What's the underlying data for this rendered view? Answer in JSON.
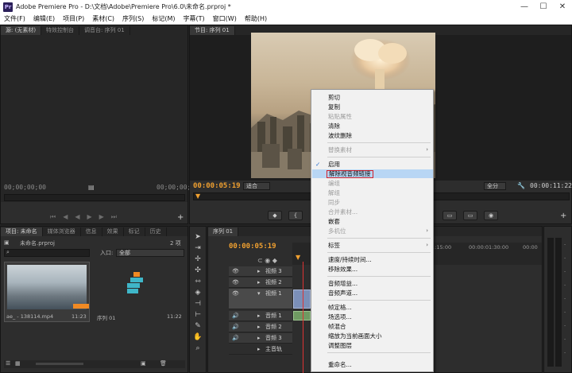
{
  "app": {
    "logo": "Pr",
    "title": "Adobe Premiere Pro - D:\\文档\\Adobe\\Premiere Pro\\6.0\\未命名.prproj *"
  },
  "menubar": [
    "文件(F)",
    "编辑(E)",
    "项目(P)",
    "素材(C)",
    "序列(S)",
    "标记(M)",
    "字幕(T)",
    "窗口(W)",
    "帮助(H)"
  ],
  "source_panel": {
    "tabs": [
      "源: (无素材)",
      "特效控制台",
      "调音台: 序列 01"
    ],
    "timecode_left": "00;00;00;00",
    "timecode_right": "00;00;00;00"
  },
  "program_panel": {
    "tab": "节目: 序列 01",
    "timecode": "00:00:05:19",
    "fit_label": "适合",
    "quality_label": "全分",
    "duration": "00:00:11:22"
  },
  "project_panel": {
    "tabs": [
      "项目: 未命名",
      "媒体浏览器",
      "信息",
      "效果",
      "标记",
      "历史"
    ],
    "file": "未命名.prproj",
    "item_count": "2 项",
    "inpoint_label": "入口:",
    "inpoint_value": "全部",
    "clips": [
      {
        "name": "ae_ - 138114.mp4",
        "duration": "11:23"
      },
      {
        "name": "序列 01",
        "duration": "11:22"
      }
    ]
  },
  "timeline": {
    "tab": "序列 01",
    "timecode": "00:00:05:19",
    "ruler": [
      "00:00:01:15:00",
      "00:00:01:30:00",
      "00:00"
    ],
    "tracks": [
      {
        "label": "视频 3",
        "type": "video"
      },
      {
        "label": "视频 2",
        "type": "video"
      },
      {
        "label": "视频 1",
        "type": "video"
      },
      {
        "label": "音频 1",
        "type": "audio"
      },
      {
        "label": "音频 2",
        "type": "audio"
      },
      {
        "label": "音频 3",
        "type": "audio"
      },
      {
        "label": "主音轨",
        "type": "master"
      }
    ]
  },
  "context_menu": {
    "items": [
      {
        "label": "剪切",
        "enabled": true
      },
      {
        "label": "复制",
        "enabled": true
      },
      {
        "label": "粘贴属性",
        "enabled": false
      },
      {
        "label": "清除",
        "enabled": true
      },
      {
        "label": "波纹删除",
        "enabled": true
      },
      {
        "label": "替换素材",
        "enabled": false,
        "submenu": true
      },
      {
        "label": "启用",
        "enabled": true,
        "checked": true
      },
      {
        "label": "解除视音频链接",
        "enabled": true,
        "highlighted": true
      },
      {
        "label": "编组",
        "enabled": false
      },
      {
        "label": "解组",
        "enabled": false
      },
      {
        "label": "同步",
        "enabled": false
      },
      {
        "label": "合并素材...",
        "enabled": false
      },
      {
        "label": "嵌套",
        "enabled": true
      },
      {
        "label": "多机位",
        "enabled": false,
        "submenu": true
      },
      {
        "label": "标签",
        "enabled": true,
        "submenu": true
      },
      {
        "label": "速度/持续时间...",
        "enabled": true
      },
      {
        "label": "移除效果...",
        "enabled": true
      },
      {
        "label": "音频增益...",
        "enabled": true
      },
      {
        "label": "音频声道...",
        "enabled": true
      },
      {
        "label": "帧定格...",
        "enabled": true
      },
      {
        "label": "场选项...",
        "enabled": true
      },
      {
        "label": "帧混合",
        "enabled": true
      },
      {
        "label": "缩放为当前画面大小",
        "enabled": true
      },
      {
        "label": "调整图层",
        "enabled": true
      },
      {
        "label": "重命名...",
        "enabled": true
      }
    ]
  },
  "colors": {
    "timecode": "#f0a030",
    "highlight": "#b8d6f4",
    "highlight_border": "#d0202a",
    "panel": "#2d2d2d"
  }
}
